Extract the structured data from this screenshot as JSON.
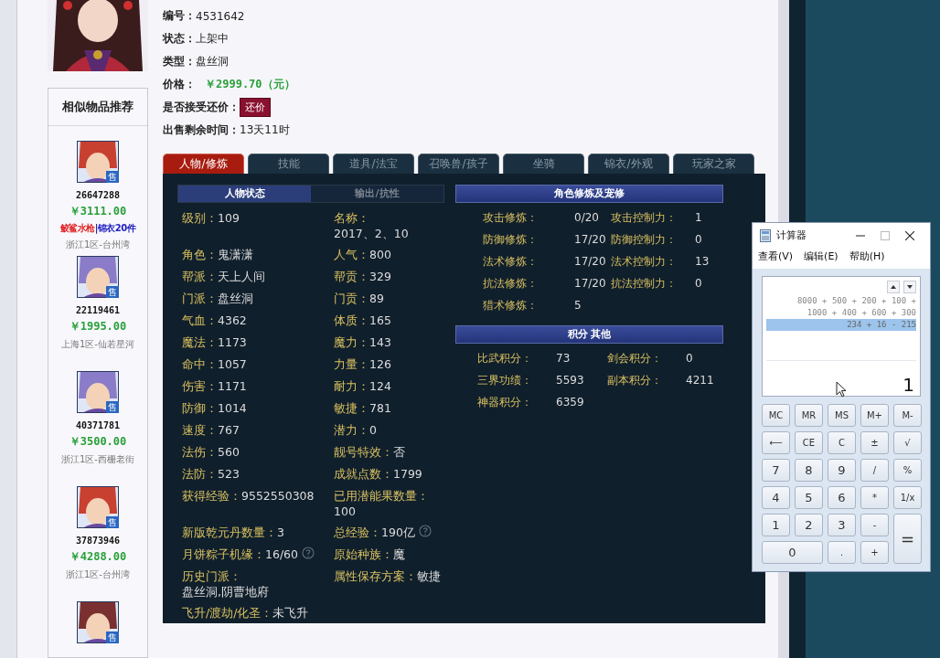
{
  "listing": {
    "fields": [
      {
        "kind": "text",
        "label": "编号：",
        "value": "4531642"
      },
      {
        "kind": "text",
        "label": "状态：",
        "value": "上架中"
      },
      {
        "kind": "text",
        "label": "类型：",
        "value": "盘丝洞"
      },
      {
        "kind": "price",
        "label": "价格：",
        "value": "￥2999.70（元）"
      },
      {
        "kind": "button",
        "label": "是否接受还价：",
        "value": "还价"
      },
      {
        "kind": "text",
        "label": "出售剩余时间：",
        "value": "13天11时"
      }
    ]
  },
  "similar": {
    "title": "相似物品推荐",
    "items": [
      {
        "badge": "售",
        "id": "26647288",
        "price": "￥3111.00",
        "tags": [
          {
            "text": "鲛鲨水枪",
            "color": "#e02020"
          },
          {
            "text": "|锦衣20件",
            "color": "#2020c0"
          }
        ],
        "server": "浙江1区-台州湾"
      },
      {
        "badge": "售",
        "id": "22119461",
        "price": "￥1995.00",
        "server": "上海1区-仙若星河"
      },
      {
        "badge": "售",
        "id": "40371781",
        "price": "￥3500.00",
        "server": "浙江1区-西栅老街"
      },
      {
        "badge": "售",
        "id": "37873946",
        "price": "￥4288.00",
        "server": "浙江1区-台州湾"
      },
      {
        "badge": "售"
      }
    ]
  },
  "tabs": [
    {
      "label": "人物/修炼",
      "selected": true
    },
    {
      "label": "技能",
      "selected": false
    },
    {
      "label": "道具/法宝",
      "selected": false
    },
    {
      "label": "召唤兽/孩子",
      "selected": false
    },
    {
      "label": "坐骑",
      "selected": false
    },
    {
      "label": "锦衣/外观",
      "selected": false
    },
    {
      "label": "玩家之家",
      "selected": false
    }
  ],
  "subtabs": [
    {
      "label": "人物状态",
      "selected": true
    },
    {
      "label": "输出/抗性",
      "selected": false
    }
  ],
  "stats": [
    {
      "label": "级别：",
      "value": "109"
    },
    {
      "label": "名称：",
      "value": "2017、2、10"
    },
    {
      "label": "角色：",
      "value": "鬼潇潇"
    },
    {
      "label": "人气：",
      "value": "800"
    },
    {
      "label": "帮派：",
      "value": "天上人间"
    },
    {
      "label": "帮贡：",
      "value": "329"
    },
    {
      "label": "门派：",
      "value": "盘丝洞"
    },
    {
      "label": "门贡：",
      "value": "89"
    },
    {
      "label": "气血：",
      "value": "4362"
    },
    {
      "label": "体质：",
      "value": "165"
    },
    {
      "label": "魔法：",
      "value": "1173"
    },
    {
      "label": "魔力：",
      "value": "143"
    },
    {
      "label": "命中：",
      "value": "1057"
    },
    {
      "label": "力量：",
      "value": "126"
    },
    {
      "label": "伤害：",
      "value": "1171"
    },
    {
      "label": "耐力：",
      "value": "124"
    },
    {
      "label": "防御：",
      "value": "1014"
    },
    {
      "label": "敏捷：",
      "value": "781"
    },
    {
      "label": "速度：",
      "value": "767"
    },
    {
      "label": "潜力：",
      "value": "0"
    },
    {
      "label": "法伤：",
      "value": "560"
    },
    {
      "label": "靓号特效：",
      "value": "否"
    },
    {
      "label": "法防：",
      "value": "523"
    },
    {
      "label": "成就点数：",
      "value": "1799"
    },
    {
      "label": "获得经验：",
      "value": "9552550308"
    },
    {
      "label": "已用潜能果数量：",
      "value": "100"
    },
    {
      "label": "新版乾元丹数量：",
      "value": "3"
    },
    {
      "label": "总经验：",
      "value": "190亿",
      "help": true
    },
    {
      "label": "月饼粽子机缘：",
      "value": "16/60",
      "help": true
    },
    {
      "label": "原始种族：",
      "value": "魔"
    },
    {
      "label": "历史门派：",
      "value": "盘丝洞,阴曹地府"
    },
    {
      "label": "属性保存方案：",
      "value": "敏捷"
    },
    {
      "label": "飞升/渡劫/化圣：",
      "value": "未飞升"
    }
  ],
  "sections": [
    {
      "title": "角色修炼及宠修",
      "items": [
        {
          "label": "攻击修炼：",
          "value": "0/20"
        },
        {
          "label": "攻击控制力：",
          "value": "1"
        },
        {
          "label": "防御修炼：",
          "value": "17/20"
        },
        {
          "label": "防御控制力：",
          "value": "0"
        },
        {
          "label": "法术修炼：",
          "value": "17/20"
        },
        {
          "label": "法术控制力：",
          "value": "13"
        },
        {
          "label": "抗法修炼：",
          "value": "17/20"
        },
        {
          "label": "抗法控制力：",
          "value": "0"
        },
        {
          "label": "猎术修炼：",
          "value": "5"
        }
      ]
    },
    {
      "title": "积分 其他",
      "items": [
        {
          "label": "比武积分：",
          "value": "73"
        },
        {
          "label": "剑会积分：",
          "value": "0"
        },
        {
          "label": "三界功绩：",
          "value": "5593"
        },
        {
          "label": "副本积分：",
          "value": "4211"
        },
        {
          "label": "神器积分：",
          "value": "6359"
        }
      ]
    }
  ],
  "calculator": {
    "title": "计算器",
    "menu": [
      "查看(V)",
      "编辑(E)",
      "帮助(H)"
    ],
    "history": [
      {
        "text": "8000 + 500 + 200 + 100 +",
        "selected": false
      },
      {
        "text": "1000 + 400 + 600 + 300",
        "selected": false
      },
      {
        "text": "234 + 16 - 215",
        "selected": true
      }
    ],
    "display": "1",
    "keys": [
      {
        "label": "MC",
        "kind": "normal"
      },
      {
        "label": "MR",
        "kind": "normal"
      },
      {
        "label": "MS",
        "kind": "normal"
      },
      {
        "label": "M+",
        "kind": "normal"
      },
      {
        "label": "M-",
        "kind": "normal"
      },
      {
        "label": "⟵",
        "kind": "normal"
      },
      {
        "label": "CE",
        "kind": "normal"
      },
      {
        "label": "C",
        "kind": "normal"
      },
      {
        "label": "±",
        "kind": "normal"
      },
      {
        "label": "√",
        "kind": "normal"
      },
      {
        "label": "7",
        "kind": "digit"
      },
      {
        "label": "8",
        "kind": "digit"
      },
      {
        "label": "9",
        "kind": "digit"
      },
      {
        "label": "/",
        "kind": "normal"
      },
      {
        "label": "%",
        "kind": "normal"
      },
      {
        "label": "4",
        "kind": "digit"
      },
      {
        "label": "5",
        "kind": "digit"
      },
      {
        "label": "6",
        "kind": "digit"
      },
      {
        "label": "*",
        "kind": "normal"
      },
      {
        "label": "1/x",
        "kind": "normal"
      },
      {
        "label": "1",
        "kind": "digit"
      },
      {
        "label": "2",
        "kind": "digit"
      },
      {
        "label": "3",
        "kind": "digit"
      },
      {
        "label": "-",
        "kind": "normal"
      },
      {
        "label": "=",
        "kind": "tall"
      },
      {
        "label": "0",
        "kind": "wide"
      },
      {
        "label": ".",
        "kind": "normal"
      },
      {
        "label": "+",
        "kind": "normal"
      }
    ]
  }
}
